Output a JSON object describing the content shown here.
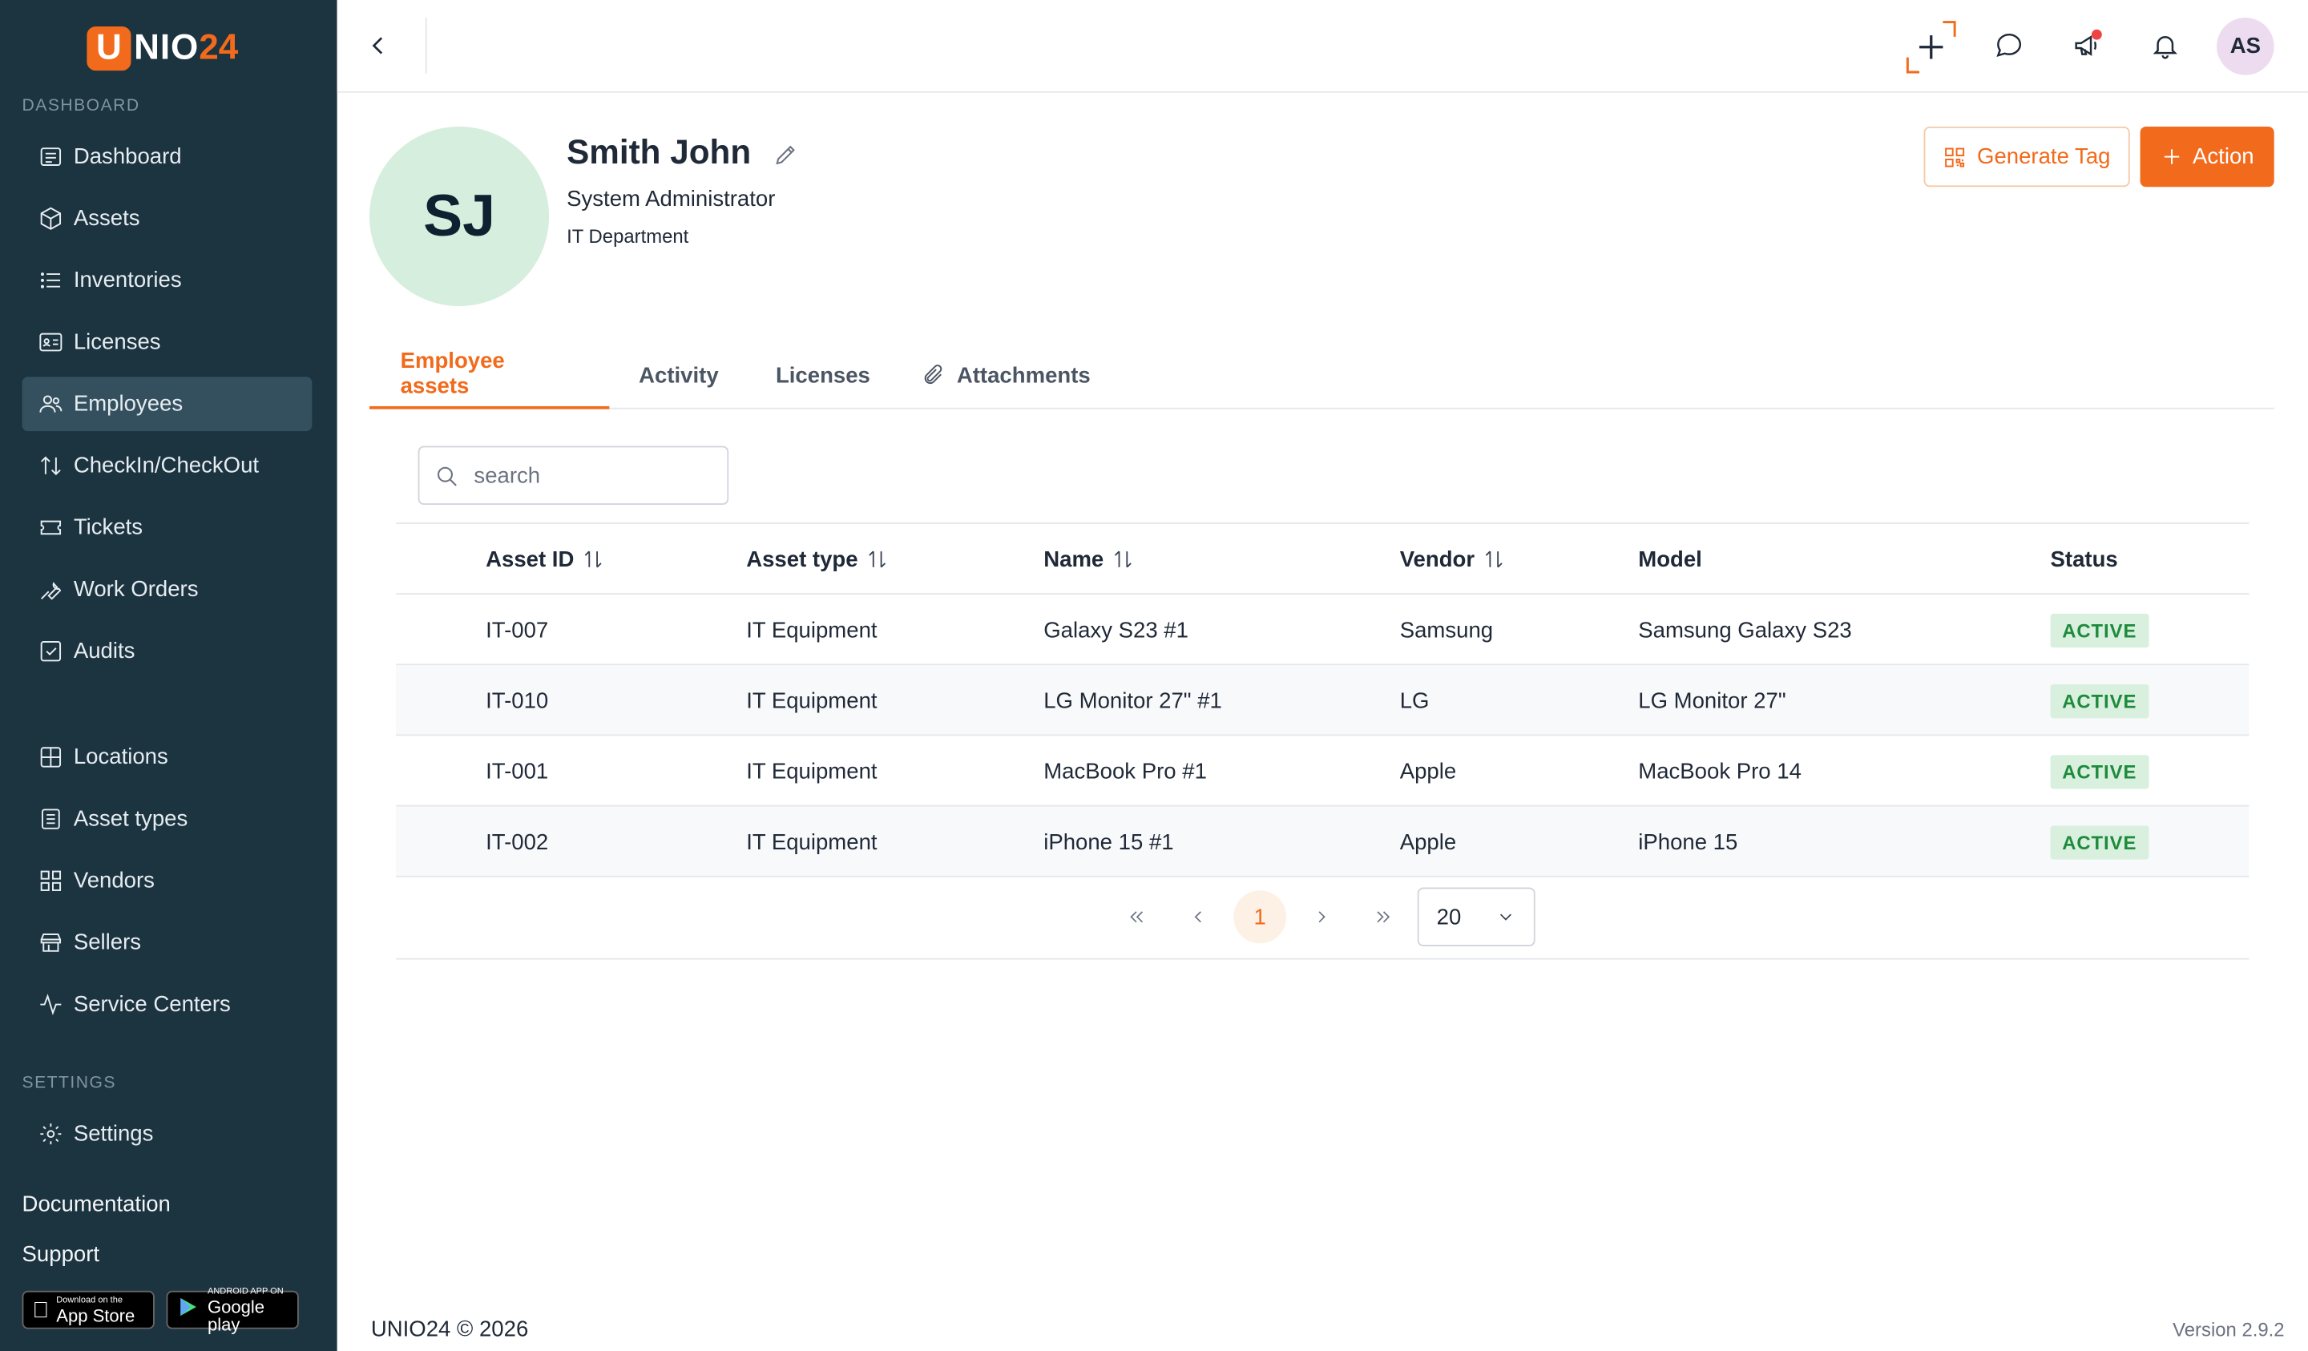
{
  "brand": {
    "logo_letter": "U",
    "logo_text": "NIO",
    "logo_num": "24",
    "accent": "#f26a1b",
    "sidebar_bg": "#1c3340"
  },
  "sidebar": {
    "dashboard_label": "DASHBOARD",
    "items": [
      {
        "label": "Dashboard",
        "icon": "dashboard-icon"
      },
      {
        "label": "Assets",
        "icon": "cube-icon"
      },
      {
        "label": "Inventories",
        "icon": "list-icon"
      },
      {
        "label": "Licenses",
        "icon": "license-card-icon"
      },
      {
        "label": "Employees",
        "icon": "users-icon",
        "active": true
      },
      {
        "label": "CheckIn/CheckOut",
        "icon": "arrows-updown-icon"
      },
      {
        "label": "Tickets",
        "icon": "ticket-icon"
      },
      {
        "label": "Work Orders",
        "icon": "wrench-icon"
      },
      {
        "label": "Audits",
        "icon": "checkbox-icon"
      }
    ],
    "items2": [
      {
        "label": "Locations",
        "icon": "grid-icon"
      },
      {
        "label": "Asset types",
        "icon": "document-icon"
      },
      {
        "label": "Vendors",
        "icon": "apps-icon"
      },
      {
        "label": "Sellers",
        "icon": "store-icon"
      },
      {
        "label": "Service Centers",
        "icon": "activity-icon"
      }
    ],
    "settings_label": "SETTINGS",
    "settings_item": "Settings",
    "documentation": "Documentation",
    "support": "Support",
    "app_store_small": "Download on the",
    "app_store_big": "App Store",
    "google_small": "ANDROID APP ON",
    "google_big": "Google play"
  },
  "topbar": {
    "user_initials": "AS"
  },
  "employee": {
    "initials": "SJ",
    "name": "Smith John",
    "role": "System Administrator",
    "department": "IT Department"
  },
  "actions": {
    "generate_tag": "Generate Tag",
    "action": "Action"
  },
  "tabs": [
    {
      "label": "Employee assets",
      "active": true
    },
    {
      "label": "Activity"
    },
    {
      "label": "Licenses"
    },
    {
      "label": "Attachments"
    }
  ],
  "search": {
    "placeholder": "search"
  },
  "table": {
    "headers": [
      "Asset ID",
      "Asset type",
      "Name",
      "Vendor",
      "Model",
      "Status"
    ],
    "rows": [
      [
        "IT-007",
        "IT Equipment",
        "Galaxy S23 #1",
        "Samsung",
        "Samsung Galaxy S23",
        "ACTIVE"
      ],
      [
        "IT-010",
        "IT Equipment",
        "LG Monitor 27\" #1",
        "LG",
        "LG Monitor 27\"",
        "ACTIVE"
      ],
      [
        "IT-001",
        "IT Equipment",
        "MacBook Pro #1",
        "Apple",
        "MacBook Pro 14",
        "ACTIVE"
      ],
      [
        "IT-002",
        "IT Equipment",
        "iPhone 15 #1",
        "Apple",
        "iPhone 15",
        "ACTIVE"
      ]
    ]
  },
  "pagination": {
    "current_page": "1",
    "page_size": "20"
  },
  "footer": {
    "copyright": "UNIO24 © 2026",
    "version": "Version 2.9.2"
  }
}
